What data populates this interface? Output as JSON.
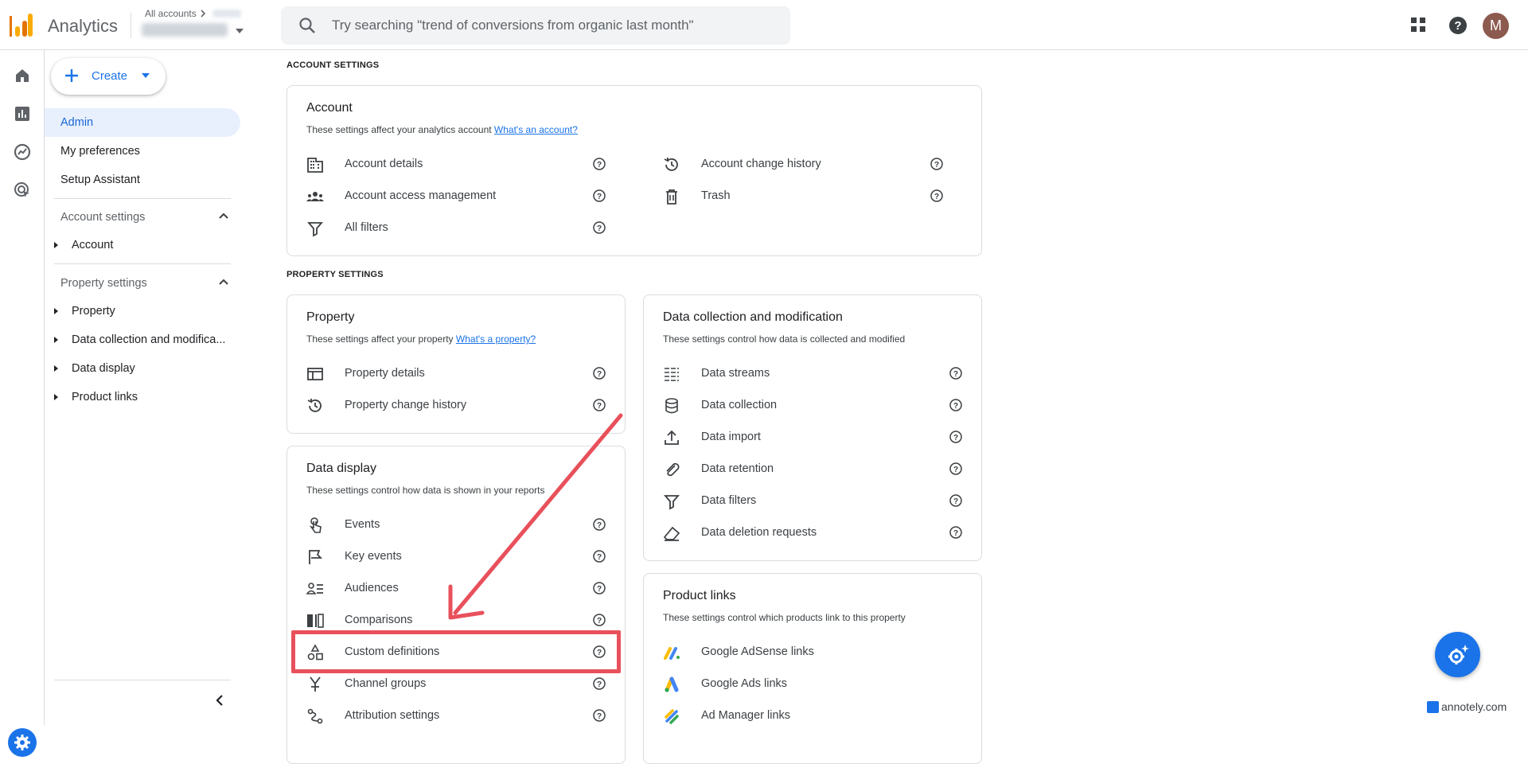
{
  "topbar": {
    "app_title": "Analytics",
    "accounts_crumb": "All accounts",
    "search_placeholder": "Try searching \"trend of conversions from organic last month\"",
    "avatar_initial": "M"
  },
  "sidenav": {
    "create_label": "Create",
    "items": [
      "Admin",
      "My preferences",
      "Setup Assistant"
    ],
    "account_section": "Account settings",
    "account_items": [
      "Account"
    ],
    "property_section": "Property settings",
    "property_items": [
      "Property",
      "Data collection and modifica...",
      "Data display",
      "Product links"
    ]
  },
  "main": {
    "account_settings_label": "ACCOUNT SETTINGS",
    "property_settings_label": "PROPERTY SETTINGS",
    "account_card": {
      "title": "Account",
      "desc": "These settings affect your analytics account",
      "link": "What's an account?",
      "left_rows": [
        "Account details",
        "Account access management",
        "All filters"
      ],
      "right_rows": [
        "Account change history",
        "Trash"
      ]
    },
    "property_card": {
      "title": "Property",
      "desc": "These settings affect your property",
      "link": "What's a property?",
      "rows": [
        "Property details",
        "Property change history"
      ]
    },
    "data_display_card": {
      "title": "Data display",
      "desc": "These settings control how data is shown in your reports",
      "rows": [
        "Events",
        "Key events",
        "Audiences",
        "Comparisons",
        "Custom definitions",
        "Channel groups",
        "Attribution settings"
      ]
    },
    "data_collection_card": {
      "title": "Data collection and modification",
      "desc": "These settings control how data is collected and modified",
      "rows": [
        "Data streams",
        "Data collection",
        "Data import",
        "Data retention",
        "Data filters",
        "Data deletion requests"
      ]
    },
    "product_links_card": {
      "title": "Product links",
      "desc": "These settings control which products link to this property",
      "rows": [
        "Google AdSense links",
        "Google Ads links",
        "Ad Manager links"
      ]
    }
  },
  "watermark": "annotely.com",
  "colors": {
    "accent": "#1a73e8",
    "highlight": "#e8505b",
    "active_bg": "#e8f0fe"
  }
}
